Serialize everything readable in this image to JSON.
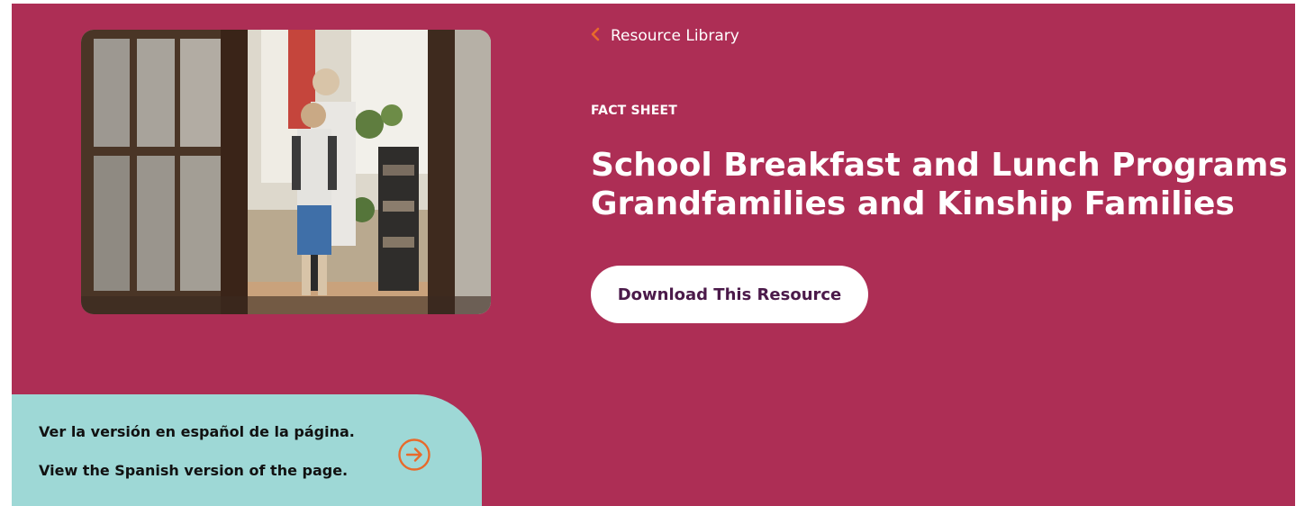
{
  "colors": {
    "hero_bg": "#ad2e55",
    "text_on_hero": "#ffffff",
    "accent_orange": "#e86a2b",
    "button_bg": "#ffffff",
    "button_text": "#4b1a4a",
    "lang_panel_bg": "#9ed8d6",
    "lang_text": "#111111"
  },
  "breadcrumb": {
    "icon": "chevron-left-icon",
    "label": "Resource Library"
  },
  "eyebrow": "FACT SHEET",
  "title": {
    "line1": "School Breakfast and Lunch Programs for",
    "line2": "Grandfamilies and Kinship Families"
  },
  "download_button": {
    "label": "Download This Resource"
  },
  "hero_image": {
    "alt": "Grandmother helping a child with a backpack in a doorway"
  },
  "language_switch": {
    "spanish_line": "Ver la versión en español de la página.",
    "english_line": "View the Spanish version of the page.",
    "icon": "arrow-right-circle-icon"
  }
}
